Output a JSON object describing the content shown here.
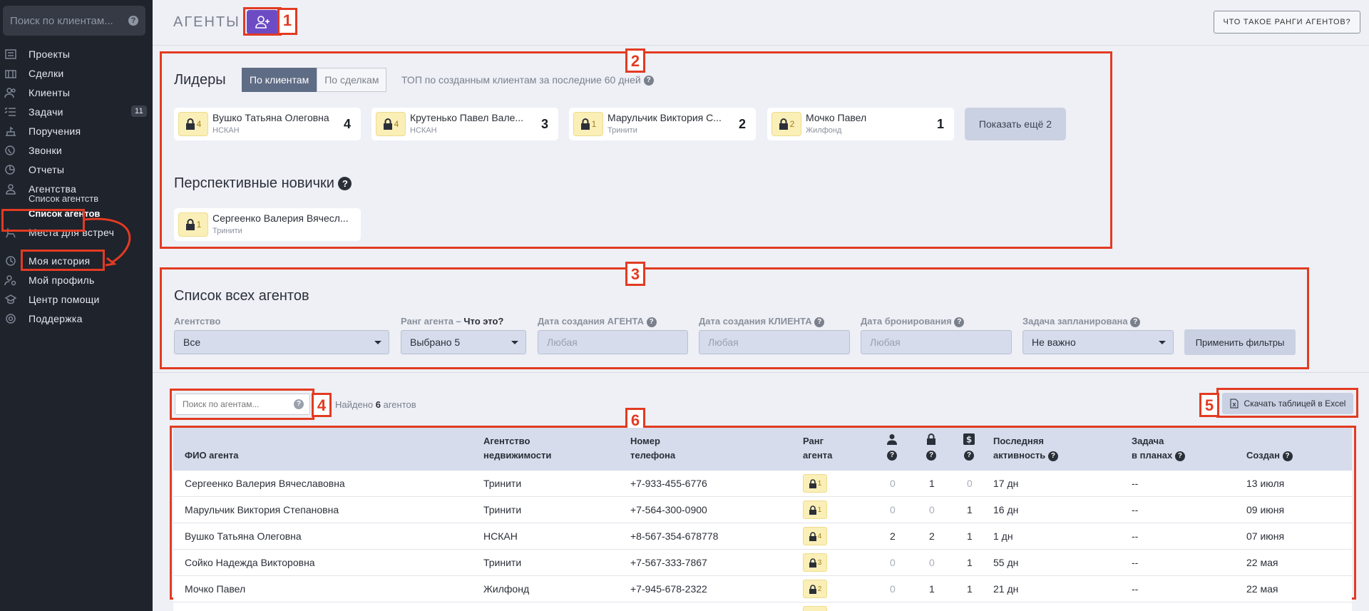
{
  "sidebar": {
    "search_placeholder": "Поиск по клиентам...",
    "items": [
      {
        "label": "Проекты",
        "icon": "projects-icon"
      },
      {
        "label": "Сделки",
        "icon": "deals-icon"
      },
      {
        "label": "Клиенты",
        "icon": "clients-icon"
      },
      {
        "label": "Задачи",
        "icon": "tasks-icon",
        "badge": "11"
      },
      {
        "label": "Поручения",
        "icon": "assignments-icon"
      },
      {
        "label": "Звонки",
        "icon": "calls-icon"
      },
      {
        "label": "Отчеты",
        "icon": "reports-icon"
      },
      {
        "label": "Агентства",
        "icon": "agencies-icon"
      },
      {
        "label": "Места для встреч",
        "icon": "meeting-places-icon"
      },
      {
        "label": "Моя история",
        "icon": "history-icon"
      },
      {
        "label": "Мой профиль",
        "icon": "profile-icon"
      },
      {
        "label": "Центр помощи",
        "icon": "help-center-icon"
      },
      {
        "label": "Поддержка",
        "icon": "support-icon"
      }
    ],
    "subitems": [
      {
        "label": "Список агентств"
      },
      {
        "label": "Список агентов",
        "active": true
      }
    ]
  },
  "header": {
    "title": "АГЕНТЫ",
    "ranks_button": "ЧТО ТАКОЕ РАНГИ АГЕНТОВ?"
  },
  "callouts": [
    "1",
    "2",
    "3",
    "4",
    "5",
    "6"
  ],
  "leaders": {
    "title": "Лидеры",
    "toggle": [
      "По клиентам",
      "По сделкам"
    ],
    "hint": "ТОП по созданным клиентам за последние 60 дней",
    "cards": [
      {
        "rank": "4",
        "name": "Вушко Татьяна Олеговна",
        "agency": "НСКАН",
        "score": "4"
      },
      {
        "rank": "4",
        "name": "Крутенько Павел Вале...",
        "agency": "НСКАН",
        "score": "3"
      },
      {
        "rank": "1",
        "name": "Марульчик Виктория С...",
        "agency": "Тринити",
        "score": "2"
      },
      {
        "rank": "2",
        "name": "Мочко Павел",
        "agency": "Жилфонд",
        "score": "1"
      }
    ],
    "more_button": "Показать ещё 2"
  },
  "newcomers": {
    "title": "Перспективные новички",
    "cards": [
      {
        "rank": "1",
        "name": "Сергеенко Валерия Вячесл...",
        "agency": "Тринити"
      }
    ]
  },
  "filters": {
    "title": "Список всех агентов",
    "agency_label": "Агентство",
    "agency_value": "Все",
    "rank_label": "Ранг агента –",
    "rank_link": "Что это?",
    "rank_value": "Выбрано 5",
    "agent_date_label": "Дата создания АГЕНТА",
    "agent_date_placeholder": "Любая",
    "client_date_label": "Дата создания КЛИЕНТА",
    "client_date_placeholder": "Любая",
    "booking_date_label": "Дата бронирования",
    "booking_date_placeholder": "Любая",
    "task_label": "Задача запланирована",
    "task_value": "Не важно",
    "apply_button": "Применить фильтры"
  },
  "table": {
    "search_placeholder": "Поиск по агентам...",
    "found_prefix": "Найдено",
    "found_count": "6",
    "found_suffix": "агентов",
    "excel_button": "Скачать таблицей в Excel",
    "headers": {
      "name": "ФИО агента",
      "agency_1": "Агентство",
      "agency_2": "недвижимости",
      "phone_1": "Номер",
      "phone_2": "телефона",
      "rank_1": "Ранг",
      "rank_2": "агента",
      "activity_1": "Последняя",
      "activity_2": "активность",
      "task_1": "Задача",
      "task_2": "в планах",
      "created": "Создан"
    },
    "rows": [
      {
        "name": "Сергеенко Валерия Вячеславовна",
        "agency": "Тринити",
        "phone": "+7-933-455-6776",
        "rank": "1",
        "c1": "0",
        "c2": "1",
        "c3": "0",
        "activity": "17 дн",
        "task": "--",
        "created": "13 июля"
      },
      {
        "name": "Марульчик Виктория Степановна",
        "agency": "Тринити",
        "phone": "+7-564-300-0900",
        "rank": "1",
        "c1": "0",
        "c2": "0",
        "c3": "1",
        "activity": "16 дн",
        "task": "--",
        "created": "09 июня"
      },
      {
        "name": "Вушко Татьяна Олеговна",
        "agency": "НСКАН",
        "phone": "+8-567-354-678778",
        "rank": "4",
        "c1": "2",
        "c2": "2",
        "c3": "1",
        "activity": "1 дн",
        "task": "--",
        "created": "07 июня"
      },
      {
        "name": "Сойко Надежда Викторовна",
        "agency": "Тринити",
        "phone": "+7-567-333-7867",
        "rank": "3",
        "c1": "0",
        "c2": "0",
        "c3": "1",
        "activity": "55 дн",
        "task": "--",
        "created": "22 мая"
      },
      {
        "name": "Мочко Павел",
        "agency": "Жилфонд",
        "phone": "+7-945-678-2322",
        "rank": "2",
        "c1": "0",
        "c2": "1",
        "c3": "1",
        "activity": "21 дн",
        "task": "--",
        "created": "22 мая"
      }
    ]
  },
  "colors": {
    "accent": "#6d4bc4",
    "callout": "#e23b22",
    "sidebar_bg": "#1f232c",
    "rank_chip": "#fbefb8"
  }
}
